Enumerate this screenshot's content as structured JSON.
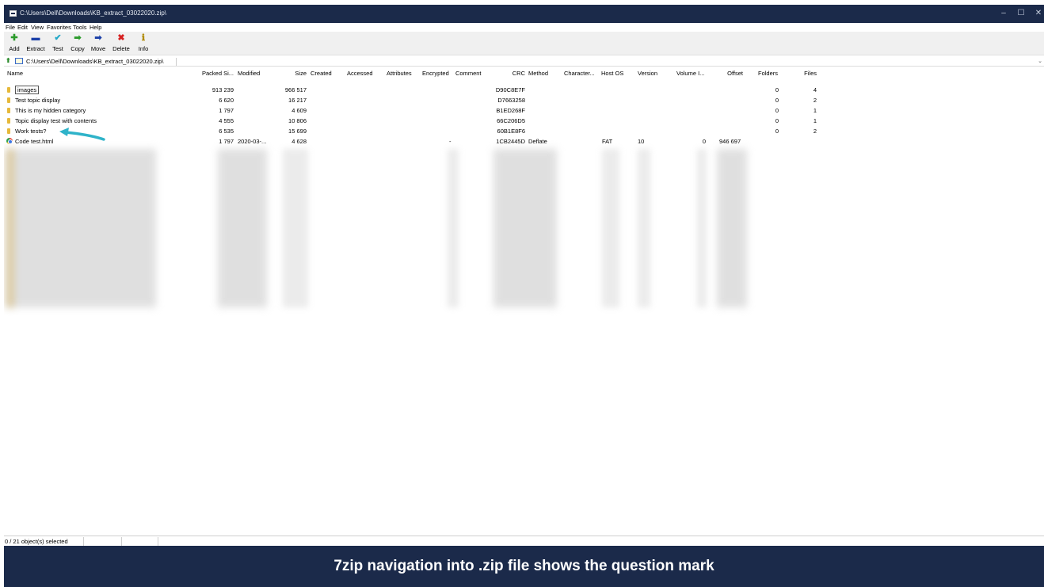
{
  "window": {
    "title": "C:\\Users\\Dell\\Downloads\\KB_extract_03022020.zip\\",
    "minimize_glyph": "–",
    "maximize_glyph": "☐",
    "close_glyph": "✕"
  },
  "menu": [
    "File",
    "Edit",
    "View",
    "Favorites",
    "Tools",
    "Help"
  ],
  "toolbar": [
    {
      "label": "Add",
      "icon": "plus-icon",
      "glyph": "✚",
      "color": "#2a9a2a"
    },
    {
      "label": "Extract",
      "icon": "minus-icon",
      "glyph": "▬",
      "color": "#1a3fa8"
    },
    {
      "label": "Test",
      "icon": "check-icon",
      "glyph": "✔",
      "color": "#23a8c8"
    },
    {
      "label": "Copy",
      "icon": "copy-arrow-icon",
      "glyph": "➡",
      "color": "#2a9a2a"
    },
    {
      "label": "Move",
      "icon": "move-arrow-icon",
      "glyph": "➡",
      "color": "#1a3fa8"
    },
    {
      "label": "Delete",
      "icon": "delete-x-icon",
      "glyph": "✖",
      "color": "#d62020"
    },
    {
      "label": "Info",
      "icon": "info-icon",
      "glyph": "ℹ",
      "color": "#b08a00"
    }
  ],
  "address": {
    "path": "C:\\Users\\Dell\\Downloads\\KB_extract_03022020.zip\\",
    "dropdown_glyph": "⌄"
  },
  "columns": [
    "Name",
    "Packed Si...",
    "Modified",
    "Size",
    "Created",
    "Accessed",
    "Attributes",
    "Encrypted",
    "Comment",
    "CRC",
    "Method",
    "Character...",
    "Host OS",
    "Version",
    "Volume I...",
    "Offset",
    "Folders",
    "Files"
  ],
  "rows": [
    {
      "name": "images",
      "type": "folder",
      "packed": "913 239",
      "modified": "",
      "size": "966 517",
      "comment": "",
      "crc": "D90C8E7F",
      "method": "",
      "host_os": "",
      "version": "",
      "volume": "",
      "offset": "",
      "folders": "0",
      "files": "4"
    },
    {
      "name": "Test topic display",
      "type": "folder",
      "packed": "6 620",
      "modified": "",
      "size": "16 217",
      "comment": "",
      "crc": "D7663258",
      "method": "",
      "host_os": "",
      "version": "",
      "volume": "",
      "offset": "",
      "folders": "0",
      "files": "2"
    },
    {
      "name": "This is my hidden category",
      "type": "folder",
      "packed": "1 797",
      "modified": "",
      "size": "4 609",
      "comment": "",
      "crc": "B1ED268F",
      "method": "",
      "host_os": "",
      "version": "",
      "volume": "",
      "offset": "",
      "folders": "0",
      "files": "1"
    },
    {
      "name": "Topic display test with contents",
      "type": "folder",
      "packed": "4 555",
      "modified": "",
      "size": "10 806",
      "comment": "",
      "crc": "66C206D5",
      "method": "",
      "host_os": "",
      "version": "",
      "volume": "",
      "offset": "",
      "folders": "0",
      "files": "1"
    },
    {
      "name": "Work tests?",
      "type": "folder",
      "packed": "6 535",
      "modified": "",
      "size": "15 699",
      "comment": "",
      "crc": "60B1E8F6",
      "method": "",
      "host_os": "",
      "version": "",
      "volume": "",
      "offset": "",
      "folders": "0",
      "files": "2"
    },
    {
      "name": "Code test.html",
      "type": "html",
      "packed": "1 797",
      "modified": "2020-03-...",
      "size": "4 628",
      "comment": "-",
      "crc": "1CB2445D",
      "method": "Deflate",
      "host_os": "FAT",
      "version": "10",
      "volume": "0",
      "offset": "946 697",
      "folders": "",
      "files": ""
    }
  ],
  "status": {
    "selection": "0 / 21 object(s) selected"
  },
  "caption": "7zip navigation into .zip file shows the question mark",
  "colors": {
    "titlebar": "#1b2a4a",
    "arrow": "#2fb3c9",
    "folder": "#e6b93b"
  }
}
